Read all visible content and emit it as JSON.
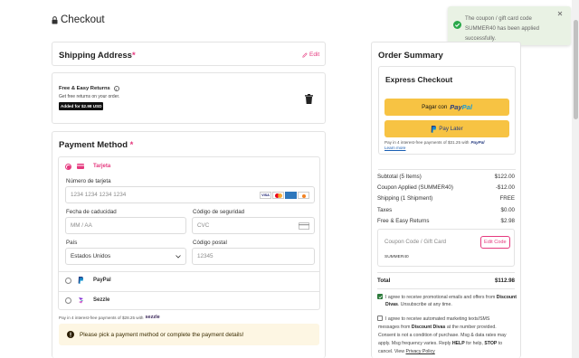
{
  "header": {
    "title": "Checkout"
  },
  "toast": {
    "line1": "The coupon / gift card code",
    "line2": "SUMMER40 has been applied",
    "line3": "successfully."
  },
  "shipping": {
    "title": "Shipping Address",
    "required_mark": "*",
    "edit_label": "Edit"
  },
  "returns": {
    "title": "Free & Easy Returns",
    "info_icon": "i",
    "desc": "Get free returns on your order.",
    "badge": "Added for $2.98 USD"
  },
  "payment": {
    "title": "Payment Method",
    "required_mark": "*",
    "tarjeta": {
      "label": "Tarjeta",
      "card_number_label": "Número de tarjeta",
      "card_number_placeholder": "1234 1234 1234 1234",
      "brands": [
        "VISA",
        "MC",
        "AMEX",
        "DISC"
      ],
      "expiry_label": "Fecha de caducidad",
      "expiry_placeholder": "MM / AA",
      "cvc_label": "Código de seguridad",
      "cvc_placeholder": "CVC",
      "country_label": "País",
      "country_value": "Estados Unidos",
      "postal_label": "Código postal",
      "postal_placeholder": "12345"
    },
    "paypal_label": "PayPal",
    "sezzle_label": "Sezzle",
    "sezzle_note_prefix": "Pay in 4 interest-free payments of $28.25 with",
    "sezzle_brand": "sezzle",
    "warning": "Please pick a payment method or complete the payment details!"
  },
  "order_summary": {
    "title": "Order Summary",
    "express": {
      "title": "Express Checkout",
      "paypal_prefix": "Pagar con",
      "paypal_brand_a": "Pay",
      "paypal_brand_b": "Pal",
      "paylater_label": "Pay Later",
      "paylater_note": "Pay in 4 interest-free payments of $31.25 with",
      "paylater_note_brand": "PayPal",
      "learn_more": "Learn more"
    },
    "rows": [
      {
        "label": "Subtotal (5 Items)",
        "value": "$122.00"
      },
      {
        "label": "Coupon Applied (SUMMER40)",
        "value": "-$12.00"
      },
      {
        "label": "Shipping (1 Shipment)",
        "value": "FREE"
      },
      {
        "label": "Taxes",
        "value": "$0.00"
      },
      {
        "label": "Free & Easy Returns",
        "value": "$2.98"
      }
    ],
    "coupon": {
      "placeholder": "Coupon Code / Gift Card",
      "button": "Edit Code",
      "applied": "SUMMER40"
    },
    "total": {
      "label": "Total",
      "value": "$112.98"
    },
    "consent1": {
      "prefix": "I agree to receive promotional emails and offers from",
      "brand": "Discount Divas",
      "suffix": ". Unsubscribe at any time."
    },
    "consent2": {
      "l1": "I agree to receive automated marketing texts/SMS",
      "l2a": "messages from",
      "l2b": "Discount Divas",
      "l2c": "at the number provided.",
      "l3": "Consent is not a condition of purchase. Msg & data rates may",
      "l4a": "apply. Msg frequency varies. Reply",
      "l4b": "HELP",
      "l4c": "for help,",
      "l4d": "STOP",
      "l4e": "to",
      "l5a": "cancel. View",
      "l5b": "Privacy Policy"
    }
  },
  "colors": {
    "accent": "#e5397e",
    "paypal_yellow": "#f7c343",
    "paypal_navy": "#253b80",
    "paypal_blue": "#179bd7",
    "warning_bg": "#fdf6e3",
    "success": "#2aa84a"
  }
}
